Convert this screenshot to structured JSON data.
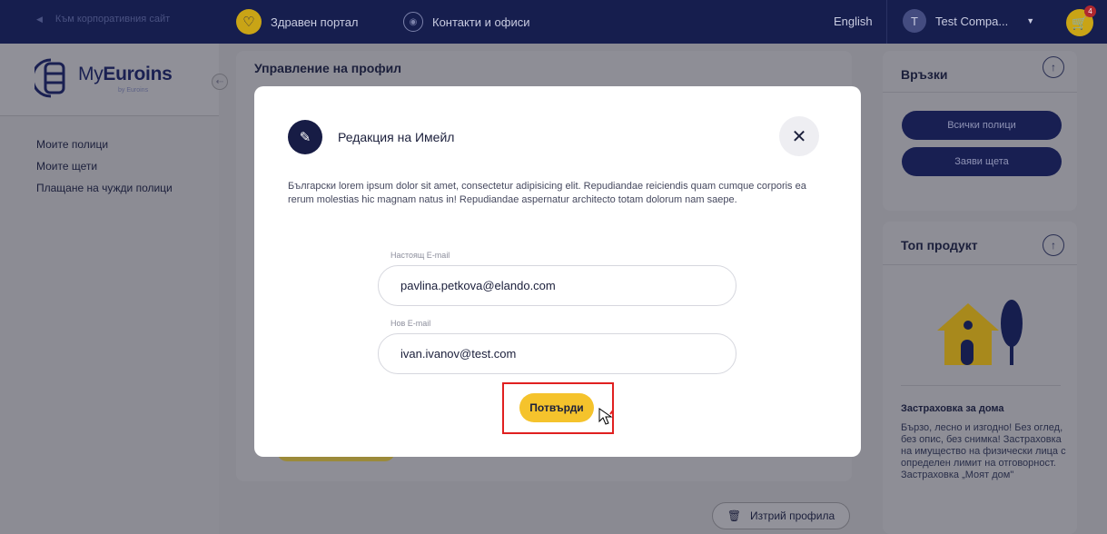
{
  "topbar": {
    "back_label": "Към корпоративния сайт",
    "health_label": "Здравен портал",
    "contacts_label": "Контакти и офиси",
    "language": "English",
    "user_initial": "T",
    "user_name": "Test Compa...",
    "cart_count": "4"
  },
  "brand": {
    "name_light": "My",
    "name_bold": "Euroins",
    "sub": "by Euroins"
  },
  "sidebar": {
    "items": [
      {
        "label": "Моите полици"
      },
      {
        "label": "Моите щети"
      },
      {
        "label": "Плащане на чужди полици"
      }
    ]
  },
  "main": {
    "title": "Управление на профил",
    "delete_label": "Изтрий профила"
  },
  "links_panel": {
    "title": "Връзки",
    "buttons": [
      {
        "label": "Всички полици"
      },
      {
        "label": "Заяви щета"
      }
    ]
  },
  "product_panel": {
    "title": "Топ продукт",
    "name": "Застраховка за дома",
    "description": "Бързо, лесно и изгодно! Без оглед, без опис, без снимка! Застраховка на имущество на физически лица с определен лимит на отговорност. Застраховка „Моят дом\""
  },
  "modal": {
    "title": "Редакция на Имейл",
    "text": "Български lorem ipsum dolor sit amet, consectetur adipisicing elit. Repudiandae reiciendis quam cumque corporis ea rerum molestias hic magnam natus in! Repudiandae aspernatur architecto totam dolorum nam saepe.",
    "current_label": "Настоящ E-mail",
    "current_value": "pavlina.petkova@elando.com",
    "new_label": "Нов E-mail",
    "new_value": "ivan.ivanov@test.com",
    "confirm_label": "Потвърди"
  },
  "colors": {
    "navy": "#161e4e",
    "accent_yellow": "#f5c32c",
    "highlight_red": "#e02020"
  }
}
